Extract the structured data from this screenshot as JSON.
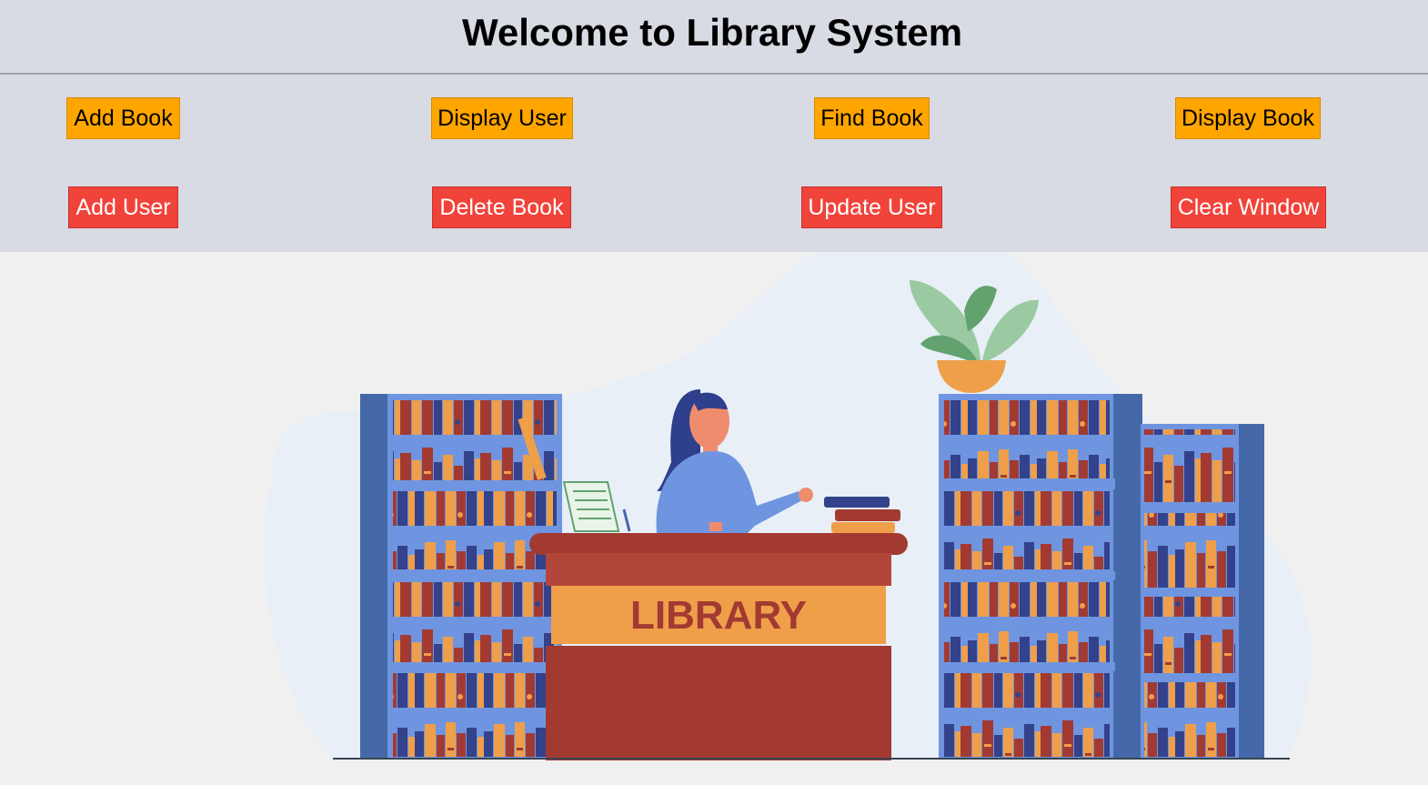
{
  "header": {
    "title": "Welcome to Library System"
  },
  "buttons": {
    "add_book": "Add Book",
    "display_user": "Display User",
    "find_book": "Find Book",
    "display_book": "Display Book",
    "add_user": "Add User",
    "delete_book": "Delete Book",
    "update_user": "Update User",
    "clear_window": "Clear Window"
  },
  "illustration": {
    "desk_sign": "LIBRARY"
  },
  "colors": {
    "header_bg": "#d8dbe3",
    "primary_button": "#ffa500",
    "danger_button": "#f0433a",
    "canvas_bg": "#f0f0f0"
  }
}
